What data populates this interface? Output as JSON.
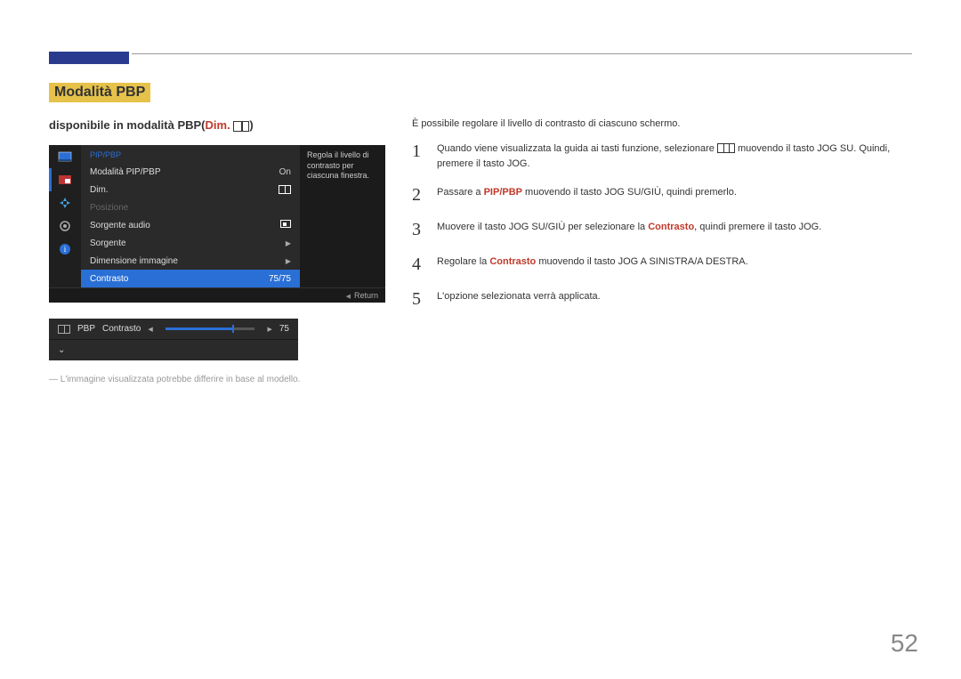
{
  "page_number": "52",
  "section_title": "Modalità PBP",
  "subtitle": {
    "prefix": "disponibile in modalità PBP(",
    "dim": "Dim.",
    "suffix": ")"
  },
  "osd": {
    "menu_title": "PIP/PBP",
    "rows": [
      {
        "label": "Modalità PIP/PBP",
        "value": "On",
        "type": "text"
      },
      {
        "label": "Dim.",
        "value": "",
        "type": "pbp-icon"
      },
      {
        "label": "Posizione",
        "value": "",
        "type": "dim"
      },
      {
        "label": "Sorgente audio",
        "value": "",
        "type": "audio-icon"
      },
      {
        "label": "Sorgente",
        "value": "",
        "type": "arrow"
      },
      {
        "label": "Dimensione immagine",
        "value": "",
        "type": "arrow"
      },
      {
        "label": "Contrasto",
        "value": "75/75",
        "type": "selected"
      }
    ],
    "description": "Regola il livello di contrasto per ciascuna finestra.",
    "return": "Return"
  },
  "slider": {
    "mode": "PBP",
    "label": "Contrasto",
    "value": "75"
  },
  "footnote": "L'immagine visualizzata potrebbe differire in base al modello.",
  "intro": "È possibile regolare il livello di contrasto di ciascuno schermo.",
  "steps": [
    {
      "n": "1",
      "pre": "Quando viene visualizzata la guida ai tasti funzione, selezionare ",
      "post": " muovendo il tasto JOG SU. Quindi, premere il tasto JOG.",
      "icon": true
    },
    {
      "n": "2",
      "pre": "Passare a ",
      "red": "PIP/PBP",
      "post": " muovendo il tasto JOG SU/GIÙ, quindi premerlo."
    },
    {
      "n": "3",
      "pre": "Muovere il tasto JOG SU/GIÙ per selezionare la ",
      "red": "Contrasto",
      "post": ", quindi premere il tasto JOG."
    },
    {
      "n": "4",
      "pre": "Regolare la ",
      "red": "Contrasto",
      "post": " muovendo il tasto JOG A SINISTRA/A DESTRA."
    },
    {
      "n": "5",
      "pre": "L'opzione selezionata verrà applicata.",
      "red": "",
      "post": ""
    }
  ]
}
